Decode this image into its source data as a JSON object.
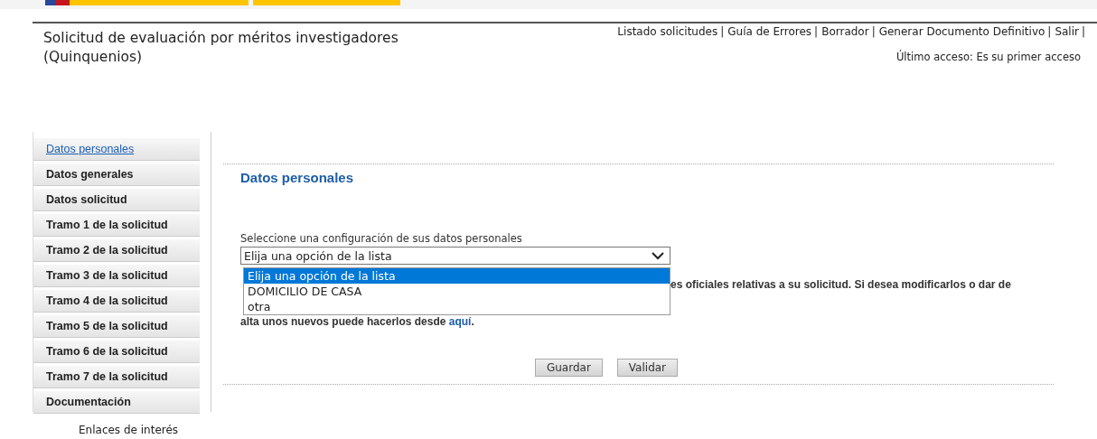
{
  "header": {
    "title": "Solicitud de evaluación por méritos investigadores (Quinquenios)",
    "separator": "|",
    "links": [
      "Listado solicitudes",
      "Guía de Errores",
      "Borrador",
      "Generar Documento Definitivo",
      "Salir"
    ],
    "last_access": "Último acceso: Es su primer acceso"
  },
  "sidebar": {
    "items": [
      {
        "label": "Datos personales",
        "selected": true
      },
      {
        "label": "Datos generales",
        "selected": false
      },
      {
        "label": "Datos solicitud",
        "selected": false
      },
      {
        "label": "Tramo 1 de la solicitud",
        "selected": false
      },
      {
        "label": "Tramo 2 de la solicitud",
        "selected": false
      },
      {
        "label": "Tramo 3 de la solicitud",
        "selected": false
      },
      {
        "label": "Tramo 4 de la solicitud",
        "selected": false
      },
      {
        "label": "Tramo 5 de la solicitud",
        "selected": false
      },
      {
        "label": "Tramo 6 de la solicitud",
        "selected": false
      },
      {
        "label": "Tramo 7 de la solicitud",
        "selected": false
      },
      {
        "label": "Documentación",
        "selected": false
      }
    ],
    "footer_link": "Enlaces de interés"
  },
  "content": {
    "heading": "Datos personales",
    "select_label": "Seleccione una configuración de sus datos personales",
    "select_value": "Elija una opción de la lista",
    "options": [
      {
        "label": "Elija una opción de la lista",
        "selected": true
      },
      {
        "label": "DOMICILIO DE CASA",
        "selected": false
      },
      {
        "label": "otra",
        "selected": false
      }
    ],
    "notice_line_1": "es oficiales relativas a su solicitud. Si desea modificarlos o dar de",
    "notice_line_2": "alta unos nuevos puede hacerlos desde",
    "notice_link": "aquí",
    "notice_end": ".",
    "buttons": [
      "Guardar",
      "Validar"
    ]
  }
}
